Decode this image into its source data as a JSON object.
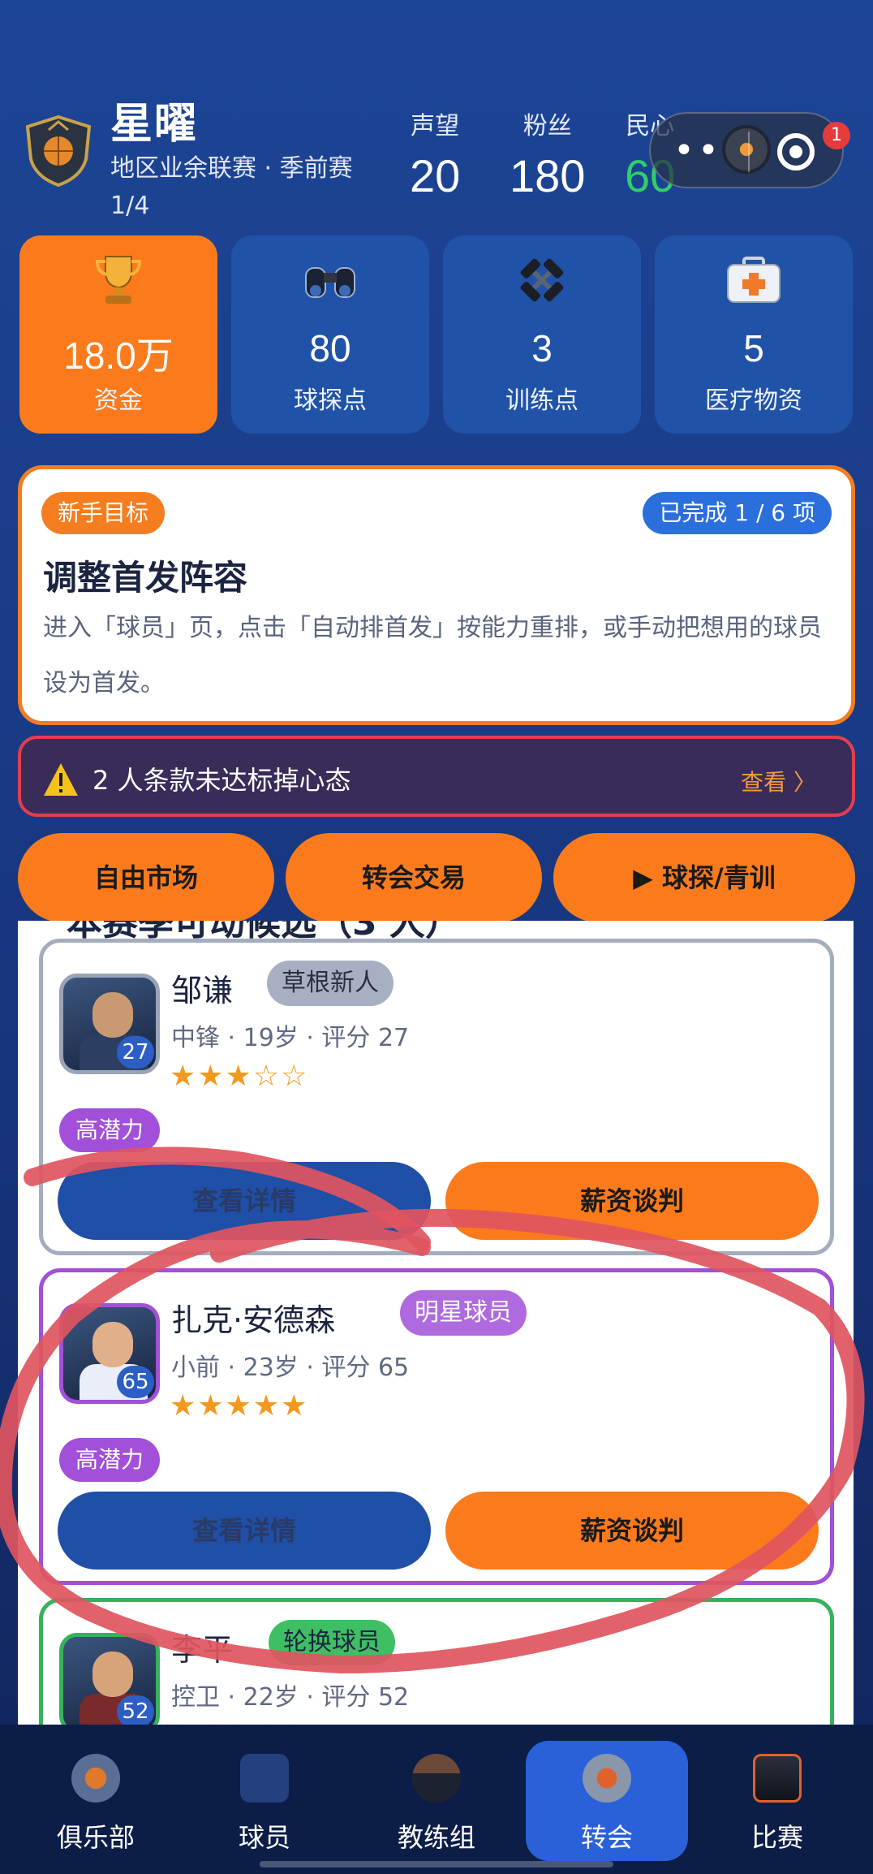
{
  "header": {
    "team_name": "星曜",
    "league": "地区业余联赛 · 季前赛",
    "round": "1/4",
    "stats": [
      {
        "label": "声望",
        "value": "20"
      },
      {
        "label": "粉丝",
        "value": "180"
      },
      {
        "label": "民心",
        "value": "60"
      }
    ],
    "notification_count": "1"
  },
  "resources": [
    {
      "value": "18.0万",
      "label": "资金",
      "icon": "trophy-icon"
    },
    {
      "value": "80",
      "label": "球探点",
      "icon": "binoculars-icon"
    },
    {
      "value": "3",
      "label": "训练点",
      "icon": "dumbbell-icon"
    },
    {
      "value": "5",
      "label": "医疗物资",
      "icon": "medkit-icon"
    }
  ],
  "goal": {
    "tag": "新手目标",
    "progress": "已完成 1 / 6 项",
    "title": "调整首发阵容",
    "description": "进入「球员」页，点击「自动排首发」按能力重排，或手动把想用的球员设为首发。"
  },
  "warning": {
    "text": "2 人条款未达标掉心态",
    "link": "查看 〉"
  },
  "tabs": [
    "自由市场",
    "转会交易",
    "▶ 球探/青训"
  ],
  "list": {
    "peek_heading": "本赛季可动候选（3 人）",
    "players": [
      {
        "name": "邹谦",
        "rank": "草根新人",
        "position": "中锋",
        "age": "19岁",
        "rating_text": "评分 27",
        "rating": "27",
        "stars": "★★★☆☆",
        "tag": "高潜力",
        "detail_label": "查看详情",
        "nego_label": "薪资谈判"
      },
      {
        "name": "扎克·安德森",
        "rank": "明星球员",
        "position": "小前",
        "age": "23岁",
        "rating_text": "评分 65",
        "rating": "65",
        "stars": "★★★★★",
        "tag": "高潜力",
        "detail_label": "查看详情",
        "nego_label": "薪资谈判"
      },
      {
        "name": "李平",
        "rank": "轮换球员",
        "position": "控卫",
        "age": "22岁",
        "rating_text": "评分 52",
        "rating": "52",
        "stars": "★★★★★",
        "tag": "",
        "detail_label": "",
        "nego_label": ""
      }
    ],
    "meta_separator": " · "
  },
  "bottom_nav": [
    {
      "label": "俱乐部",
      "icon": "club-icon"
    },
    {
      "label": "球员",
      "icon": "jersey-icon"
    },
    {
      "label": "教练组",
      "icon": "coach-icon"
    },
    {
      "label": "转会",
      "icon": "transfer-icon",
      "active": true
    },
    {
      "label": "比赛",
      "icon": "scoreboard-icon"
    }
  ],
  "colors": {
    "accent_orange": "#fb7b1c",
    "primary_blue": "#2053a8",
    "morale_green": "#2fce6a",
    "star_rank_purple": "#a24fd9",
    "rotation_green": "#37b25c",
    "annotation_red": "#e0555f"
  }
}
